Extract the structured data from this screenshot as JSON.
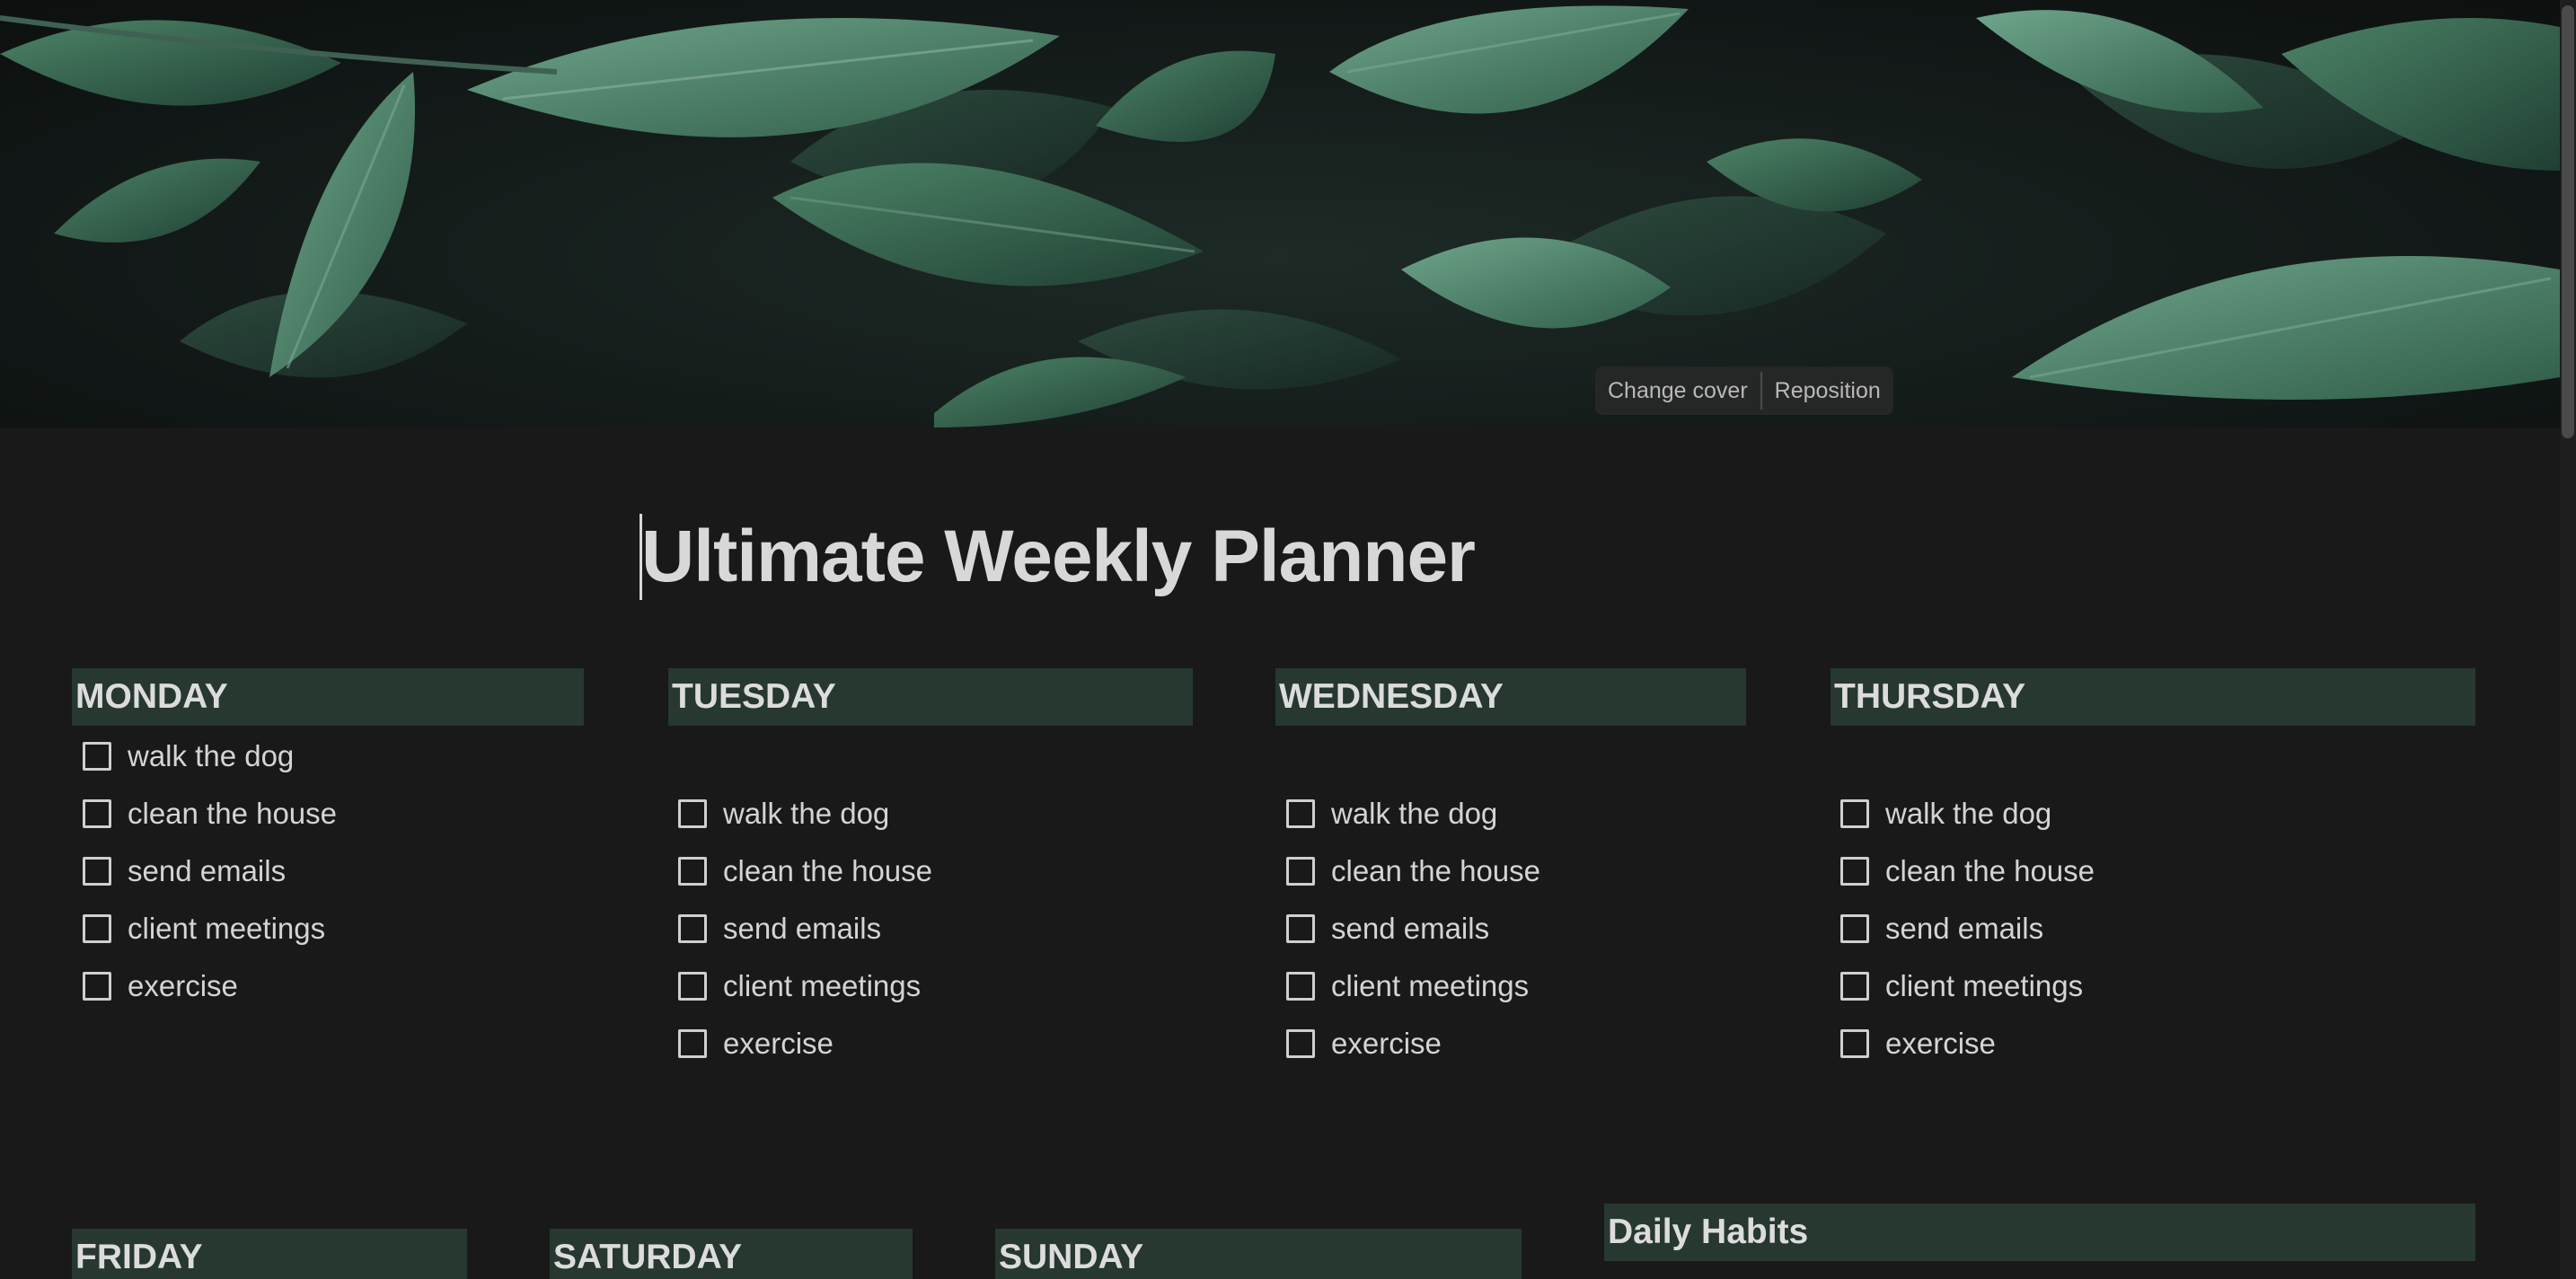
{
  "cover": {
    "change_label": "Change cover",
    "reposition_label": "Reposition"
  },
  "page": {
    "title": "Ultimate Weekly Planner"
  },
  "days": [
    {
      "name": "MONDAY",
      "tasks": [
        "walk the dog",
        "clean the house",
        "send emails",
        "client meetings",
        "exercise"
      ]
    },
    {
      "name": "TUESDAY",
      "tasks": [
        "walk the dog",
        "clean the house",
        "send emails",
        "client meetings",
        "exercise"
      ]
    },
    {
      "name": "WEDNESDAY",
      "tasks": [
        "walk the dog",
        "clean the house",
        "send emails",
        "client meetings",
        "exercise"
      ]
    },
    {
      "name": "THURSDAY",
      "tasks": [
        "walk the dog",
        "clean the house",
        "send emails",
        "client meetings",
        "exercise"
      ]
    },
    {
      "name": "FRIDAY",
      "tasks": []
    },
    {
      "name": "SATURDAY",
      "tasks": []
    },
    {
      "name": "SUNDAY",
      "tasks": []
    }
  ],
  "habits": {
    "title": "Daily Habits"
  },
  "colors": {
    "background": "#191919",
    "header_bg": "#26382f",
    "text": "#d4d4d4"
  }
}
